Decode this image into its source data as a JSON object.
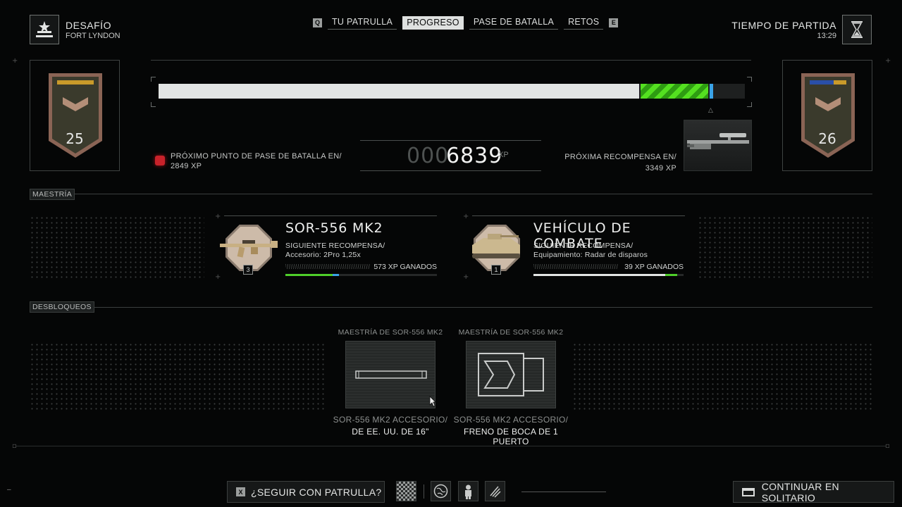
{
  "header": {
    "mode_title": "DESAFÍO",
    "mode_subtitle": "FORT LYNDON",
    "tab_key_left": "Q",
    "tab_key_right": "E",
    "tabs": [
      {
        "label": "TU PATRULLA",
        "active": false
      },
      {
        "label": "PROGRESO",
        "active": true
      },
      {
        "label": "PASE DE BATALLA",
        "active": false
      },
      {
        "label": "RETOS",
        "active": false
      }
    ],
    "time_title": "TIEMPO DE PARTIDA",
    "time_value": "13:29"
  },
  "rank": {
    "current": "25",
    "next": "26",
    "progress_prev_fraction": 0.82,
    "progress_gain_fraction": 0.115,
    "xp_zeros": "000",
    "xp_value": "6839",
    "xp_unit": "XP"
  },
  "battle_pass": {
    "line1": "PRÓXIMO PUNTO DE PASE DE BATALLA EN/",
    "line2": "2849  XP"
  },
  "next_reward": {
    "line1": "PRÓXIMA RECOMPENSA EN/",
    "line2": "3349 XP"
  },
  "mastery": {
    "section_label": "MAESTRÍA",
    "items": [
      {
        "title": "SOR-556 MK2",
        "level": "3",
        "line1": "SIGUIENTE RECOMPENSA/",
        "line2": "Accesorio: 2Pro 1,25x",
        "xp_text": "573 XP GANADOS",
        "progress_prev": 0.31,
        "progress_gain": 0.045
      },
      {
        "title": "VEHÍCULO DE COMBATE",
        "level": "1",
        "line1": "SIGUIENTE RECOMPENSA/",
        "line2": "Equipamiento: Radar de disparos",
        "xp_text": "39 XP GANADOS",
        "progress_prev": 0.88,
        "progress_gain": 0.08
      }
    ]
  },
  "unlocks": {
    "section_label": "DESBLOQUEOS",
    "items": [
      {
        "category": "MAESTRÍA DE SOR-556 MK2",
        "name_line1": "SOR-556 MK2 ACCESORIO/",
        "name_line2": "DE EE. UU. DE 16\""
      },
      {
        "category": "MAESTRÍA DE SOR-556 MK2",
        "name_line1": "SOR-556 MK2 ACCESORIO/",
        "name_line2": "FRENO DE BOCA DE 1 PUERTO"
      }
    ]
  },
  "footer": {
    "squad_key": "X",
    "squad_label": "¿SEGUIR CON PATRULLA?",
    "continue_label": "CONTINUAR EN SOLITARIO",
    "icons": [
      "qr-code-icon",
      "globe-icon",
      "soldier-icon",
      "scratch-icon"
    ]
  },
  "colors": {
    "xp_gain": "#54e020",
    "xp_marker": "#3aa3e8",
    "bar_fill": "#e3e5e4",
    "background": "#050606"
  }
}
